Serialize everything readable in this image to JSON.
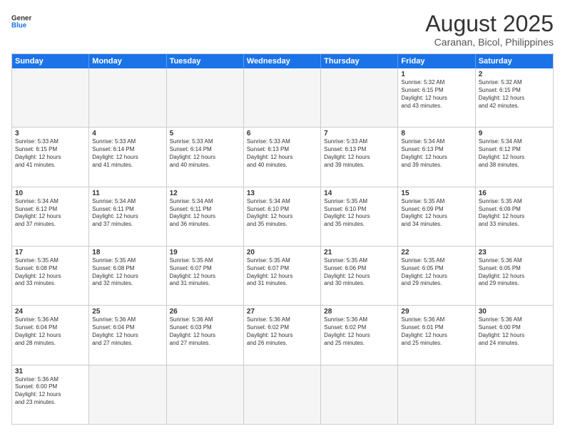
{
  "header": {
    "logo_general": "General",
    "logo_blue": "Blue",
    "month_year": "August 2025",
    "location": "Caranan, Bicol, Philippines"
  },
  "days_of_week": [
    "Sunday",
    "Monday",
    "Tuesday",
    "Wednesday",
    "Thursday",
    "Friday",
    "Saturday"
  ],
  "weeks": [
    [
      {
        "day": "",
        "info": ""
      },
      {
        "day": "",
        "info": ""
      },
      {
        "day": "",
        "info": ""
      },
      {
        "day": "",
        "info": ""
      },
      {
        "day": "",
        "info": ""
      },
      {
        "day": "1",
        "info": "Sunrise: 5:32 AM\nSunset: 6:15 PM\nDaylight: 12 hours\nand 43 minutes."
      },
      {
        "day": "2",
        "info": "Sunrise: 5:32 AM\nSunset: 6:15 PM\nDaylight: 12 hours\nand 42 minutes."
      }
    ],
    [
      {
        "day": "3",
        "info": "Sunrise: 5:33 AM\nSunset: 6:15 PM\nDaylight: 12 hours\nand 41 minutes."
      },
      {
        "day": "4",
        "info": "Sunrise: 5:33 AM\nSunset: 6:14 PM\nDaylight: 12 hours\nand 41 minutes."
      },
      {
        "day": "5",
        "info": "Sunrise: 5:33 AM\nSunset: 6:14 PM\nDaylight: 12 hours\nand 40 minutes."
      },
      {
        "day": "6",
        "info": "Sunrise: 5:33 AM\nSunset: 6:13 PM\nDaylight: 12 hours\nand 40 minutes."
      },
      {
        "day": "7",
        "info": "Sunrise: 5:33 AM\nSunset: 6:13 PM\nDaylight: 12 hours\nand 39 minutes."
      },
      {
        "day": "8",
        "info": "Sunrise: 5:34 AM\nSunset: 6:13 PM\nDaylight: 12 hours\nand 39 minutes."
      },
      {
        "day": "9",
        "info": "Sunrise: 5:34 AM\nSunset: 6:12 PM\nDaylight: 12 hours\nand 38 minutes."
      }
    ],
    [
      {
        "day": "10",
        "info": "Sunrise: 5:34 AM\nSunset: 6:12 PM\nDaylight: 12 hours\nand 37 minutes."
      },
      {
        "day": "11",
        "info": "Sunrise: 5:34 AM\nSunset: 6:11 PM\nDaylight: 12 hours\nand 37 minutes."
      },
      {
        "day": "12",
        "info": "Sunrise: 5:34 AM\nSunset: 6:11 PM\nDaylight: 12 hours\nand 36 minutes."
      },
      {
        "day": "13",
        "info": "Sunrise: 5:34 AM\nSunset: 6:10 PM\nDaylight: 12 hours\nand 35 minutes."
      },
      {
        "day": "14",
        "info": "Sunrise: 5:35 AM\nSunset: 6:10 PM\nDaylight: 12 hours\nand 35 minutes."
      },
      {
        "day": "15",
        "info": "Sunrise: 5:35 AM\nSunset: 6:09 PM\nDaylight: 12 hours\nand 34 minutes."
      },
      {
        "day": "16",
        "info": "Sunrise: 5:35 AM\nSunset: 6:09 PM\nDaylight: 12 hours\nand 33 minutes."
      }
    ],
    [
      {
        "day": "17",
        "info": "Sunrise: 5:35 AM\nSunset: 6:08 PM\nDaylight: 12 hours\nand 33 minutes."
      },
      {
        "day": "18",
        "info": "Sunrise: 5:35 AM\nSunset: 6:08 PM\nDaylight: 12 hours\nand 32 minutes."
      },
      {
        "day": "19",
        "info": "Sunrise: 5:35 AM\nSunset: 6:07 PM\nDaylight: 12 hours\nand 31 minutes."
      },
      {
        "day": "20",
        "info": "Sunrise: 5:35 AM\nSunset: 6:07 PM\nDaylight: 12 hours\nand 31 minutes."
      },
      {
        "day": "21",
        "info": "Sunrise: 5:35 AM\nSunset: 6:06 PM\nDaylight: 12 hours\nand 30 minutes."
      },
      {
        "day": "22",
        "info": "Sunrise: 5:35 AM\nSunset: 6:05 PM\nDaylight: 12 hours\nand 29 minutes."
      },
      {
        "day": "23",
        "info": "Sunrise: 5:36 AM\nSunset: 6:05 PM\nDaylight: 12 hours\nand 29 minutes."
      }
    ],
    [
      {
        "day": "24",
        "info": "Sunrise: 5:36 AM\nSunset: 6:04 PM\nDaylight: 12 hours\nand 28 minutes."
      },
      {
        "day": "25",
        "info": "Sunrise: 5:36 AM\nSunset: 6:04 PM\nDaylight: 12 hours\nand 27 minutes."
      },
      {
        "day": "26",
        "info": "Sunrise: 5:36 AM\nSunset: 6:03 PM\nDaylight: 12 hours\nand 27 minutes."
      },
      {
        "day": "27",
        "info": "Sunrise: 5:36 AM\nSunset: 6:02 PM\nDaylight: 12 hours\nand 26 minutes."
      },
      {
        "day": "28",
        "info": "Sunrise: 5:36 AM\nSunset: 6:02 PM\nDaylight: 12 hours\nand 25 minutes."
      },
      {
        "day": "29",
        "info": "Sunrise: 5:36 AM\nSunset: 6:01 PM\nDaylight: 12 hours\nand 25 minutes."
      },
      {
        "day": "30",
        "info": "Sunrise: 5:36 AM\nSunset: 6:00 PM\nDaylight: 12 hours\nand 24 minutes."
      }
    ],
    [
      {
        "day": "31",
        "info": "Sunrise: 5:36 AM\nSunset: 6:00 PM\nDaylight: 12 hours\nand 23 minutes."
      },
      {
        "day": "",
        "info": ""
      },
      {
        "day": "",
        "info": ""
      },
      {
        "day": "",
        "info": ""
      },
      {
        "day": "",
        "info": ""
      },
      {
        "day": "",
        "info": ""
      },
      {
        "day": "",
        "info": ""
      }
    ]
  ]
}
